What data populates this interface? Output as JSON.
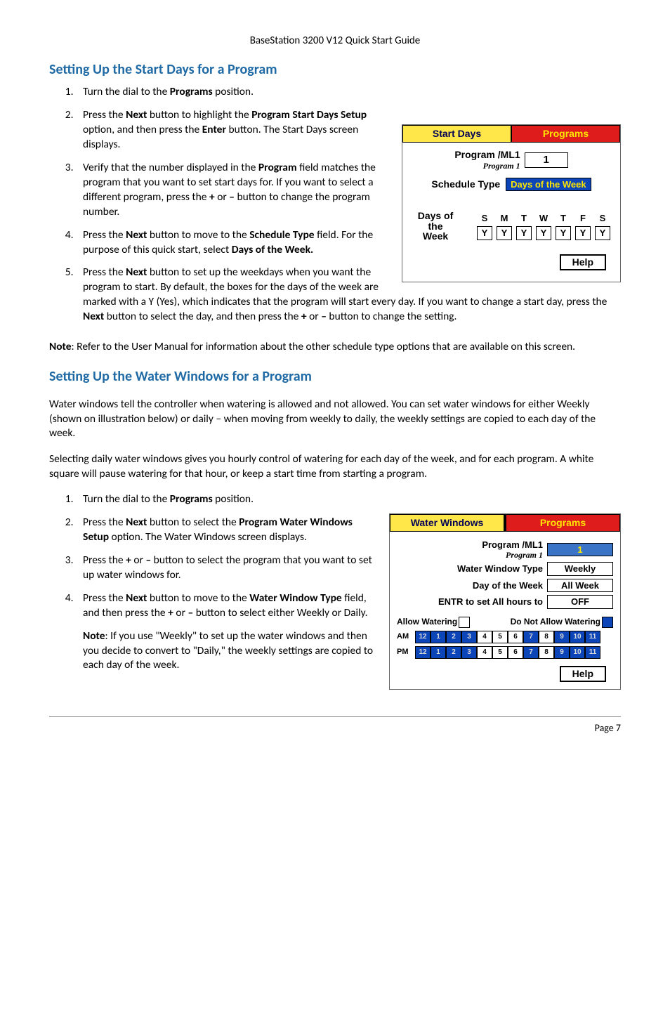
{
  "page_header": "BaseStation 3200 V12 Quick Start Guide",
  "section1": {
    "title": "Setting Up the Start Days for a Program",
    "steps": [
      "Turn the dial to the <b>Programs</b> position.",
      "Press the <b>Next</b> button to highlight the <b>Program Start Days Setup</b> option, and then press the <b>Enter</b> button. The Start Days screen displays.",
      "Verify that the number displayed in the <b>Program</b> field matches the program that you want to set start days for. If you want to select a different program, press the <b>+</b> or <b>–</b> button to change the program number.",
      "Press the <b>Next</b> button to move to the <b>Schedule Type</b> field. For the purpose of this quick start, select <b>Days of the Week.</b>",
      "Press the <b>Next</b> button to set up the weekdays when you want the program to start. By default, the boxes for the days of the week are marked with a Y (Yes), which indicates that the program will start every day. If you want to change a start day, press the <b>Next</b> button to select the day, and then press the <b>+</b> or <b>–</b> button to change the setting."
    ],
    "note": "<b>Note</b>: Refer to the User Manual for information about the other schedule type options that are available on this screen."
  },
  "fig1": {
    "tab_left": "Start Days",
    "tab_right": "Programs",
    "program_label": "Program /ML1",
    "program_sub": "Program 1",
    "program_num": "1",
    "schedule_label": "Schedule Type",
    "schedule_value": "Days of the Week",
    "dow_label": "Days of the\nWeek",
    "days": [
      "S",
      "M",
      "T",
      "W",
      "T",
      "F",
      "S"
    ],
    "vals": [
      "Y",
      "Y",
      "Y",
      "Y",
      "Y",
      "Y",
      "Y"
    ],
    "help": "Help"
  },
  "section2": {
    "title": "Setting Up the Water Windows for a Program",
    "intro1": "Water windows tell the controller when watering is allowed and not allowed. You can set water windows for either Weekly (shown on illustration below) or daily – when moving from weekly to daily, the weekly settings are copied to each day of the week.",
    "intro2": "Selecting daily water windows gives you hourly control of watering for each day of the week, and for each program. A white square will pause watering for that hour, or keep a start time from starting a program.",
    "steps": [
      "Turn the dial to the <b>Programs</b> position.",
      "Press the <b>Next</b> button to select the <b>Program Water Windows Setup</b> option. The Water Windows screen displays.",
      "Press the <b>+</b> or <b>–</b> button to select the program that you want to set up water windows for.",
      "Press the <b>Next</b> button to move to the <b>Water Window Type</b> field, and then press the <b>+</b> or <b>–</b> button to select either Weekly or Daily."
    ],
    "note_after4": "<b>Note</b>: If you use \"Weekly\" to set up the water windows and then you decide to convert to \"Daily,\" the weekly settings are copied to each day of the week."
  },
  "fig2": {
    "tab_left": "Water Windows",
    "tab_right": "Programs",
    "program_label": "Program /ML1",
    "program_sub": "Program 1",
    "program_num": "1",
    "wwtype_label": "Water Window Type",
    "wwtype_value": "Weekly",
    "dow_label": "Day of the Week",
    "dow_value": "All Week",
    "entr_label": "ENTR to set All hours to",
    "entr_value": "OFF",
    "legend_allow": "Allow Watering",
    "legend_dont": "Do Not Allow Watering",
    "hours": [
      "12",
      "1",
      "2",
      "3",
      "4",
      "5",
      "6",
      "7",
      "8",
      "9",
      "10",
      "11"
    ],
    "am_on": [
      false,
      false,
      false,
      false,
      true,
      true,
      true,
      false,
      true,
      false,
      false,
      false
    ],
    "pm_on": [
      false,
      false,
      false,
      false,
      true,
      true,
      true,
      false,
      true,
      false,
      false,
      false
    ],
    "help": "Help"
  },
  "page_number": "Page 7"
}
